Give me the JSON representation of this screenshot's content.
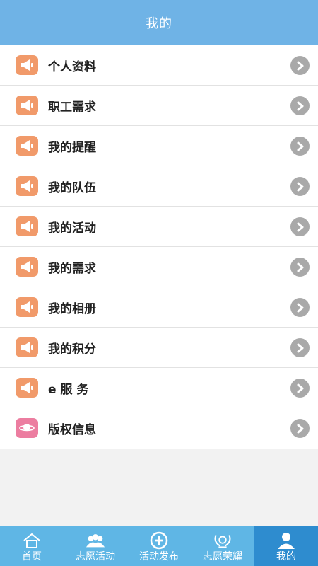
{
  "header": {
    "title": "我的"
  },
  "menu": {
    "items": [
      {
        "label": "个人资料",
        "icon": "megaphone-icon",
        "color": "#f19a6a"
      },
      {
        "label": "职工需求",
        "icon": "megaphone-icon",
        "color": "#f19a6a"
      },
      {
        "label": "我的提醒",
        "icon": "megaphone-icon",
        "color": "#f19a6a"
      },
      {
        "label": "我的队伍",
        "icon": "megaphone-icon",
        "color": "#f19a6a"
      },
      {
        "label": "我的活动",
        "icon": "megaphone-icon",
        "color": "#f19a6a"
      },
      {
        "label": "我的需求",
        "icon": "megaphone-icon",
        "color": "#f19a6a"
      },
      {
        "label": "我的相册",
        "icon": "megaphone-icon",
        "color": "#f19a6a"
      },
      {
        "label": "我的积分",
        "icon": "megaphone-icon",
        "color": "#f19a6a"
      },
      {
        "label": "e 服 务",
        "icon": "megaphone-icon",
        "color": "#f19a6a"
      },
      {
        "label": "版权信息",
        "icon": "planet-icon",
        "color": "#ec7da0"
      }
    ]
  },
  "tabbar": {
    "tabs": [
      {
        "label": "首页",
        "icon": "home-icon"
      },
      {
        "label": "志愿活动",
        "icon": "crowd-icon"
      },
      {
        "label": "活动发布",
        "icon": "plus-circle-icon"
      },
      {
        "label": "志愿荣耀",
        "icon": "laurel-icon"
      },
      {
        "label": "我的",
        "icon": "user-icon",
        "active": true
      }
    ]
  },
  "colors": {
    "header_bg": "#6fb3e6",
    "tabbar_bg": "#5fb6e5",
    "tab_active_bg": "#2e8ccf",
    "chevron": "#a9a9a9"
  }
}
